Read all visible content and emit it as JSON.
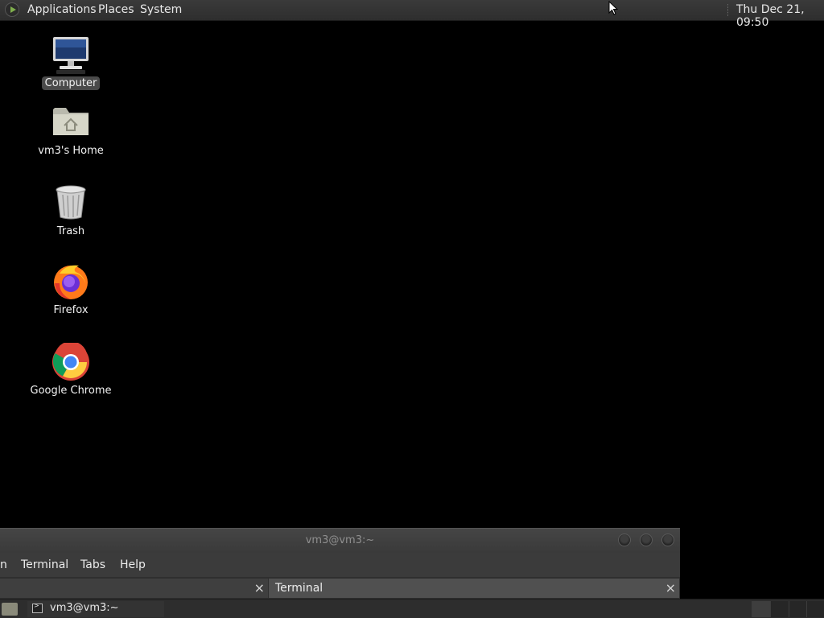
{
  "top_panel": {
    "menus": [
      "Applications",
      "Places",
      "System"
    ],
    "clock": "Thu Dec 21, 09:50"
  },
  "desktop": {
    "icons": [
      {
        "label": "Computer",
        "icon": "computer-icon",
        "selected": true
      },
      {
        "label": "vm3's Home",
        "icon": "home-folder-icon",
        "selected": false
      },
      {
        "label": "Trash",
        "icon": "trash-icon",
        "selected": false
      },
      {
        "label": "Firefox",
        "icon": "firefox-icon",
        "selected": false
      },
      {
        "label": "Google Chrome",
        "icon": "chrome-icon",
        "selected": false
      }
    ]
  },
  "terminal_window": {
    "title": "vm3@vm3:~",
    "menu_partial": "n",
    "menus": [
      "Terminal",
      "Tabs",
      "Help"
    ],
    "tabs": [
      {
        "label": ""
      },
      {
        "label": "Terminal"
      }
    ],
    "close_glyph": "×"
  },
  "bottom_panel": {
    "task_label": "vm3@vm3:~"
  }
}
